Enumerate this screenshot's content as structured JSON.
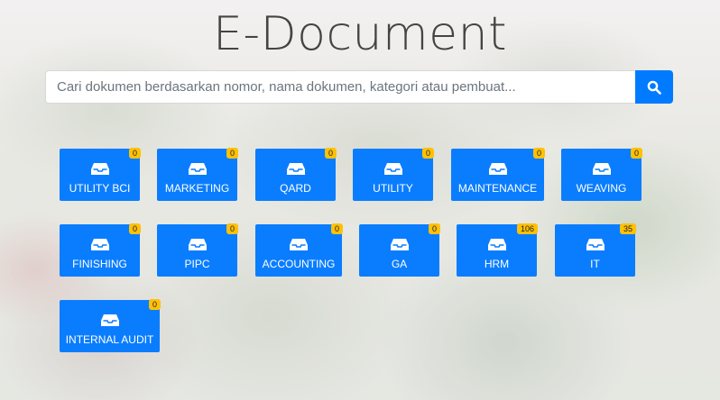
{
  "header": {
    "title": "E-Document"
  },
  "search": {
    "placeholder": "Cari dokumen berdasarkan nomor, nama dokumen, kategori atau pembuat...",
    "icon": "search-icon"
  },
  "colors": {
    "tile": "#0a7dff",
    "badge": "#ffc107",
    "button": "#007bff"
  },
  "categories": [
    {
      "label": "UTILITY BCI",
      "count": "0"
    },
    {
      "label": "MARKETING",
      "count": "0"
    },
    {
      "label": "QARD",
      "count": "0"
    },
    {
      "label": "UTILITY",
      "count": "0"
    },
    {
      "label": "MAINTENANCE",
      "count": "0"
    },
    {
      "label": "WEAVING",
      "count": "0"
    },
    {
      "label": "FINISHING",
      "count": "0"
    },
    {
      "label": "PIPC",
      "count": "0"
    },
    {
      "label": "ACCOUNTING",
      "count": "0"
    },
    {
      "label": "GA",
      "count": "0"
    },
    {
      "label": "HRM",
      "count": "106"
    },
    {
      "label": "IT",
      "count": "35"
    },
    {
      "label": "INTERNAL AUDIT",
      "count": "0"
    }
  ]
}
